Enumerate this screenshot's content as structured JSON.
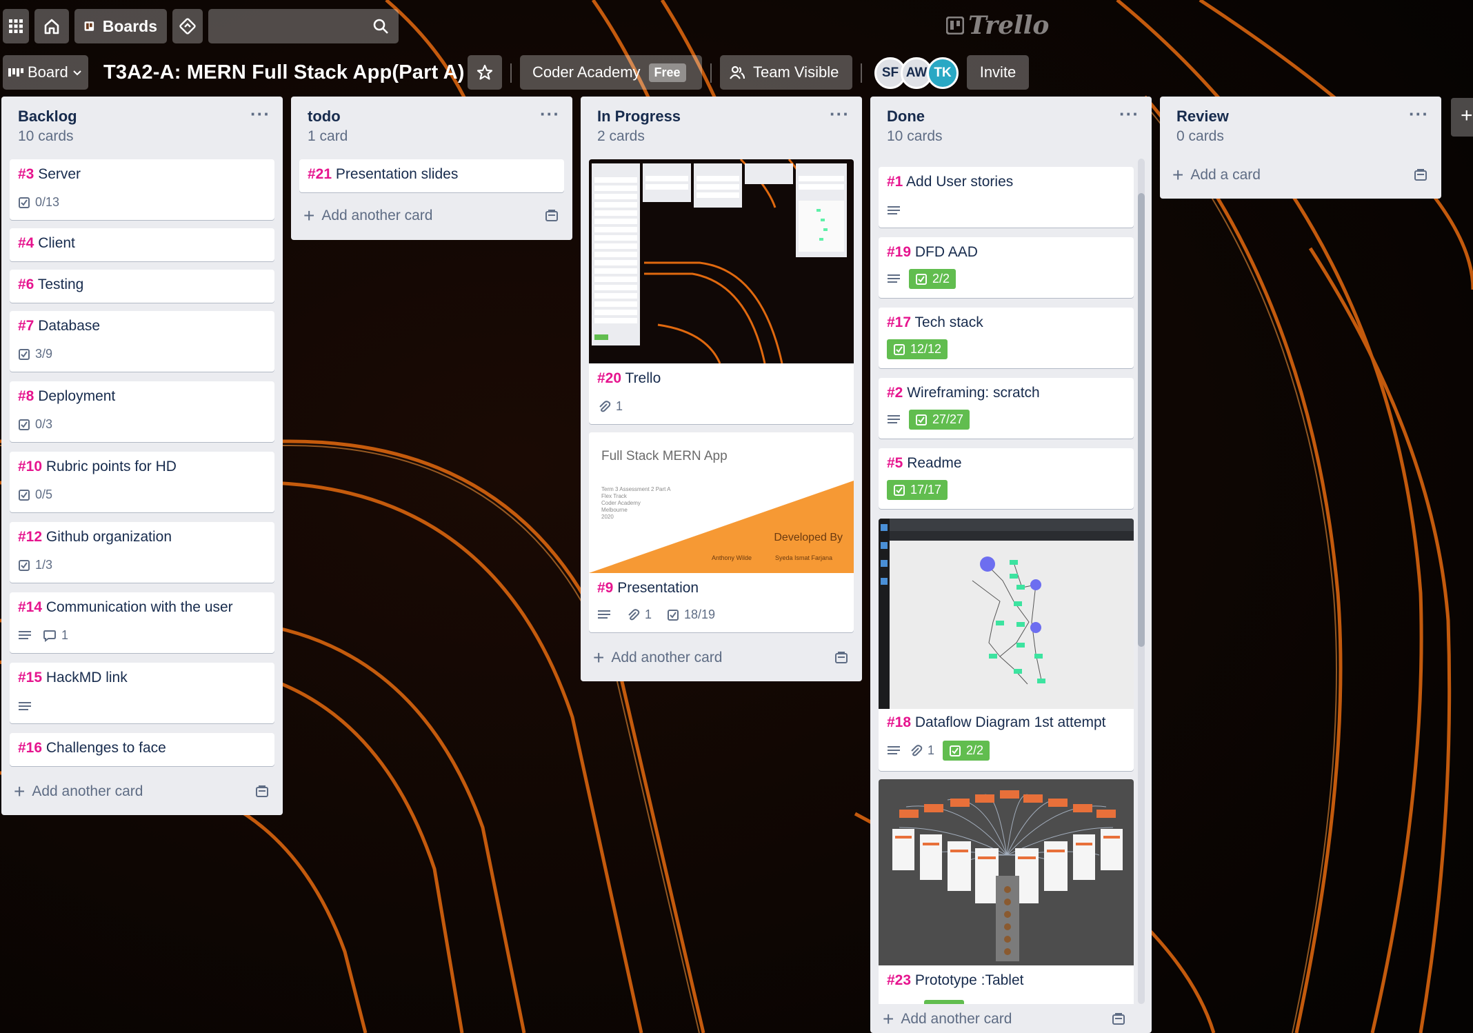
{
  "header": {
    "boards_label": "Boards",
    "search_placeholder": "",
    "logo_text": "Trello",
    "icons": [
      "apps-icon",
      "home-icon",
      "boards-icon",
      "feed-icon",
      "search-icon"
    ]
  },
  "board": {
    "menu_label": "Board",
    "title": "T3A2-A: MERN Full Stack App(Part A)",
    "team_name": "Coder Academy",
    "team_plan": "Free",
    "visibility": "Team Visible",
    "members": [
      {
        "initials": "SF",
        "color": "#dfe1e6"
      },
      {
        "initials": "AW",
        "color": "#dfe1e6"
      },
      {
        "initials": "TK",
        "color": "#29a8c4"
      }
    ],
    "invite_label": "Invite"
  },
  "colors": {
    "card_number": "#e6148e",
    "complete_badge": "#61bd4f",
    "list_bg": "#ebecf0"
  },
  "lists": {
    "backlog": {
      "title": "Backlog",
      "count": "10 cards",
      "add_label": "Add another card",
      "cards": [
        {
          "num": "#3",
          "title": "Server",
          "checklist": "0/13"
        },
        {
          "num": "#4",
          "title": "Client"
        },
        {
          "num": "#6",
          "title": "Testing"
        },
        {
          "num": "#7",
          "title": "Database",
          "checklist": "3/9"
        },
        {
          "num": "#8",
          "title": "Deployment",
          "checklist": "0/3"
        },
        {
          "num": "#10",
          "title": "Rubric points for HD",
          "checklist": "0/5"
        },
        {
          "num": "#12",
          "title": "Github organization",
          "checklist": "1/3"
        },
        {
          "num": "#14",
          "title": "Communication with the user",
          "comments": "1"
        },
        {
          "num": "#15",
          "title": "HackMD link"
        },
        {
          "num": "#16",
          "title": "Challenges to face"
        }
      ]
    },
    "todo": {
      "title": "todo",
      "count": "1 card",
      "add_label": "Add another card",
      "cards": [
        {
          "num": "#21",
          "title": "Presentation slides"
        }
      ]
    },
    "inprogress": {
      "title": "In Progress",
      "count": "2 cards",
      "add_label": "Add another card",
      "cards": [
        {
          "num": "#20",
          "title": "Trello",
          "attachments": "1"
        },
        {
          "num": "#9",
          "title": "Presentation",
          "attachments": "1",
          "checklist": "18/19",
          "cover": {
            "heading": "Full Stack MERN App",
            "lines": [
              "Term 3 Assessment 2 Part A",
              "Flex Track",
              "Coder Academy",
              "Melbourne",
              "2020"
            ],
            "developed_by": "Developed By",
            "authors": [
              "Anthony Wilde",
              "Syeda Ismat Farjana"
            ]
          }
        }
      ]
    },
    "done": {
      "title": "Done",
      "count": "10 cards",
      "add_label": "Add another card",
      "cards": [
        {
          "num": "#1",
          "title": "Add User stories"
        },
        {
          "num": "#19",
          "title": "DFD AAD",
          "checklist": "2/2"
        },
        {
          "num": "#17",
          "title": "Tech stack",
          "checklist": "12/12"
        },
        {
          "num": "#2",
          "title": "Wireframing: scratch",
          "checklist": "27/27"
        },
        {
          "num": "#5",
          "title": "Readme",
          "checklist": "17/17"
        },
        {
          "num": "#18",
          "title": "Dataflow Diagram 1st attempt",
          "attachments": "1",
          "checklist": "2/2"
        },
        {
          "num": "#23",
          "title": "Prototype :Tablet"
        }
      ]
    },
    "review": {
      "title": "Review",
      "count": "0 cards",
      "add_label": "Add a card",
      "cards": []
    }
  }
}
